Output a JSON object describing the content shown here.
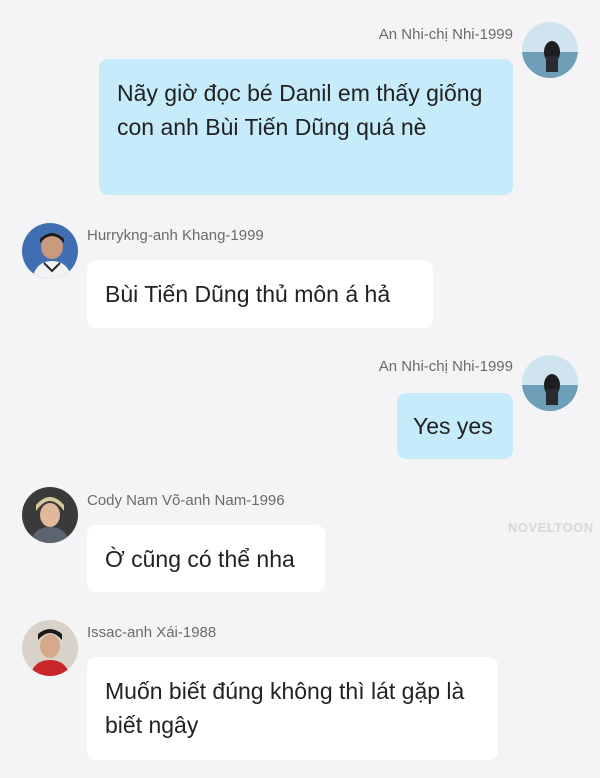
{
  "messages": [
    {
      "sender": "An Nhi-chị Nhi-1999",
      "text": "Nãy giờ đọc bé Danil em thấy giống con anh Bùi Tiến Dũng quá nè",
      "side": "right"
    },
    {
      "sender": "Hurrykng-anh Khang-1999",
      "text": "Bùi Tiến Dũng thủ môn á hả",
      "side": "left"
    },
    {
      "sender": "An Nhi-chị Nhi-1999",
      "text": "Yes yes",
      "side": "right"
    },
    {
      "sender": "Cody Nam Võ-anh Nam-1996",
      "text": "Ờ cũng có thể nha",
      "side": "left"
    },
    {
      "sender": "Issac-anh Xái-1988",
      "text": "Muốn biết đúng không thì lát gặp là biết ngây",
      "side": "left"
    }
  ],
  "watermark": "NOVELTOON",
  "colors": {
    "background": "#f4f4f6",
    "outgoing_bubble": "#c6ebfa",
    "incoming_bubble": "#ffffff",
    "sender_name": "#6b6b6b"
  }
}
